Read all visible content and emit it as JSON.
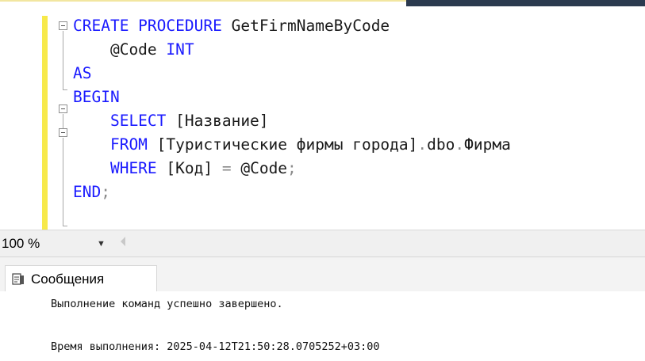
{
  "editor": {
    "lines": [
      [
        {
          "t": "CREATE PROCEDURE ",
          "c": "kw"
        },
        {
          "t": "GetFirmNameByCode",
          "c": "id"
        }
      ],
      [
        {
          "t": "    @Code ",
          "c": "id"
        },
        {
          "t": "INT",
          "c": "kw"
        }
      ],
      [
        {
          "t": "AS",
          "c": "kw"
        }
      ],
      [
        {
          "t": "BEGIN",
          "c": "kw"
        }
      ],
      [
        {
          "t": "    SELECT ",
          "c": "kw"
        },
        {
          "t": "[Название]",
          "c": "id"
        }
      ],
      [
        {
          "t": "    FROM ",
          "c": "kw"
        },
        {
          "t": "[Туристические фирмы города]",
          "c": "id"
        },
        {
          "t": ".",
          "c": "gray"
        },
        {
          "t": "dbo",
          "c": "id"
        },
        {
          "t": ".",
          "c": "gray"
        },
        {
          "t": "Фирма",
          "c": "id"
        }
      ],
      [
        {
          "t": "    WHERE ",
          "c": "kw"
        },
        {
          "t": "[Код] ",
          "c": "id"
        },
        {
          "t": "= ",
          "c": "gray"
        },
        {
          "t": "@Code",
          "c": "id"
        },
        {
          "t": ";",
          "c": "gray"
        }
      ],
      [
        {
          "t": "END",
          "c": "kw"
        },
        {
          "t": ";",
          "c": "gray"
        }
      ]
    ]
  },
  "zoom": {
    "value": "100 %"
  },
  "results": {
    "tab_label": "Сообщения",
    "messages": [
      "Выполнение команд успешно завершено.",
      "Время выполнения: 2025-04-12T21:50:28.0705252+03:00"
    ]
  },
  "colors": {
    "keyword": "#1a1aff",
    "identifier": "#1a1a1a",
    "operator": "#8a8a8a",
    "change_margin": "#f7e94a"
  }
}
